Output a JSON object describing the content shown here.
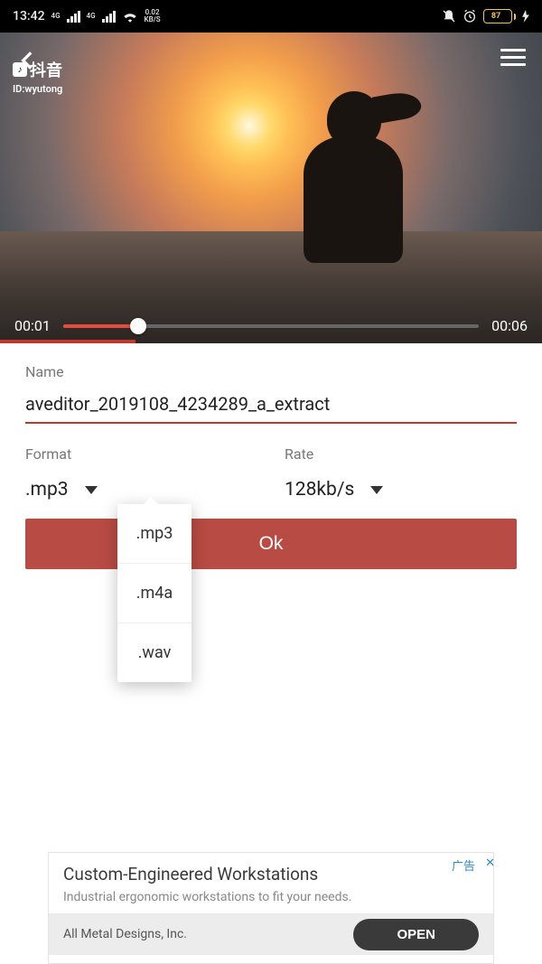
{
  "status": {
    "time": "13:42",
    "net_speed_top": "0.02",
    "net_speed_unit": "KB/S",
    "battery_pct": "87"
  },
  "watermark": {
    "app": "抖音",
    "id": "ID:wyutong"
  },
  "player": {
    "current": "00:01",
    "duration": "00:06",
    "progress_pct": 18
  },
  "form": {
    "name_label": "Name",
    "name_value": "aveditor_2019108_4234289_a_extract",
    "format_label": "Format",
    "format_value": ".mp3",
    "rate_label": "Rate",
    "rate_value": "128kb/s",
    "ok_label": "Ok"
  },
  "dropdown": {
    "options": [
      ".mp3",
      ".m4a",
      ".wav"
    ]
  },
  "ad": {
    "title": "Custom-Engineered Workstations",
    "subtitle": "Industrial ergonomic workstations to fit your needs.",
    "company": "All Metal Designs, Inc.",
    "tag": "广告",
    "close": "✕",
    "cta": "OPEN"
  }
}
